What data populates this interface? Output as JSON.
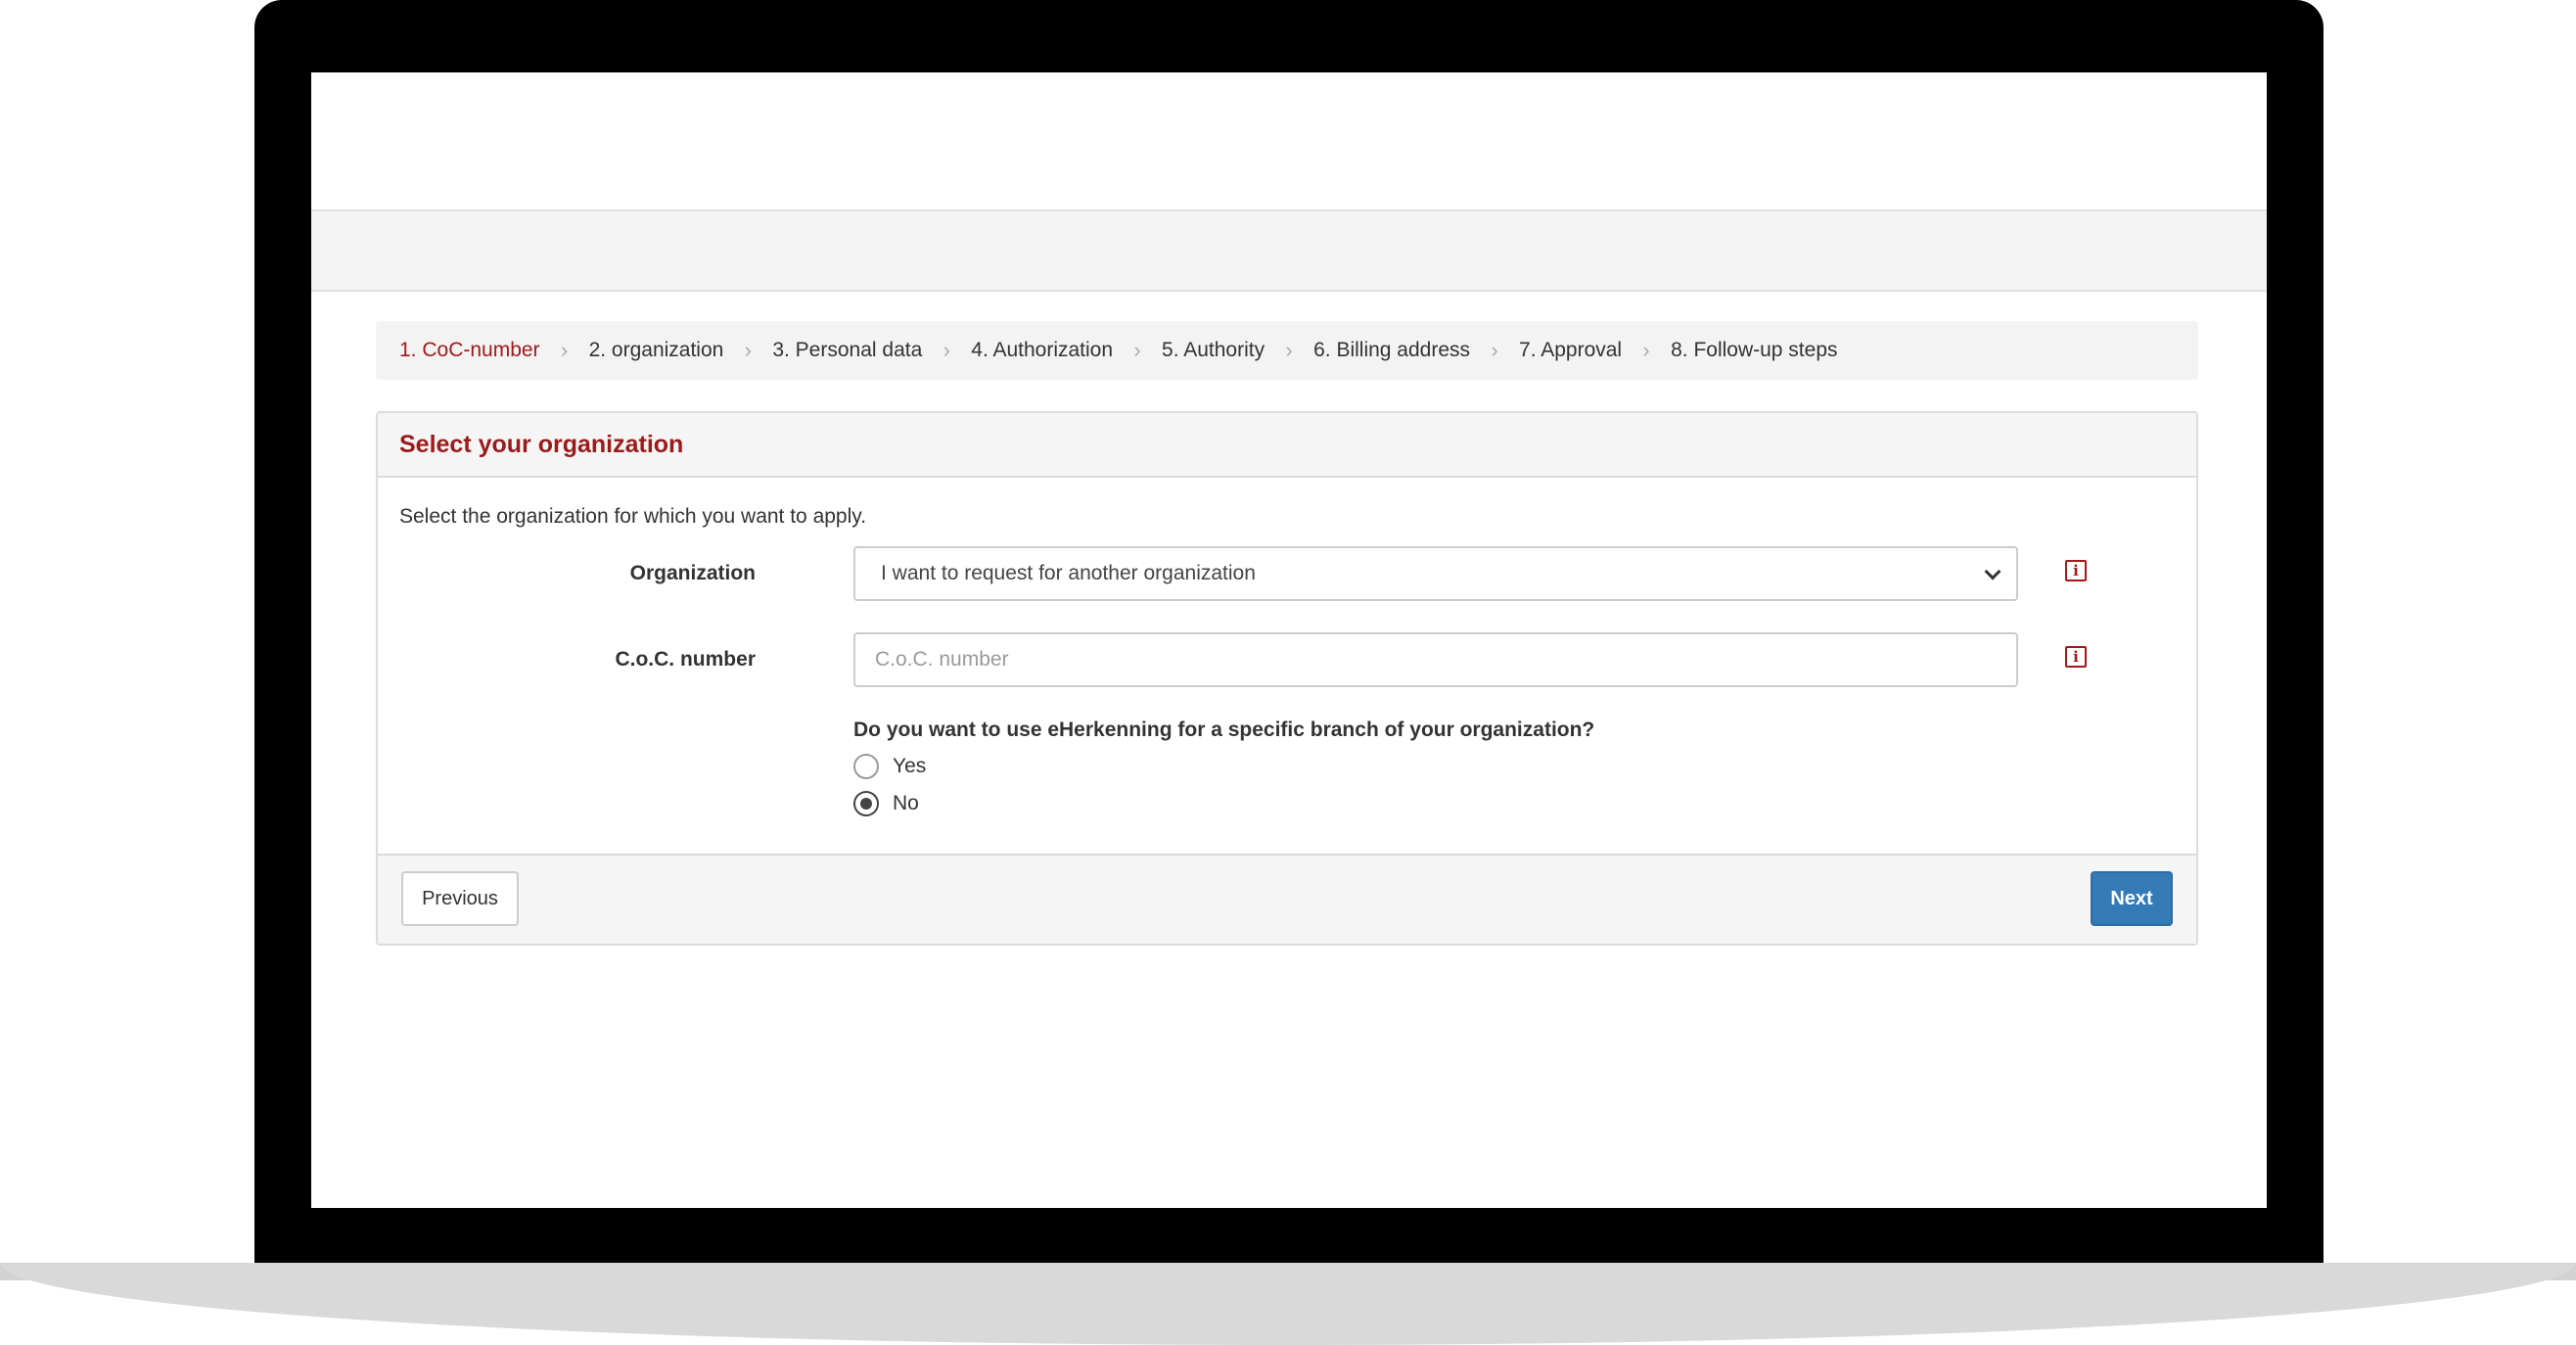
{
  "steps": [
    {
      "label": "1. CoC-number",
      "active": true
    },
    {
      "label": "2. organization"
    },
    {
      "label": "3. Personal data"
    },
    {
      "label": "4. Authorization"
    },
    {
      "label": "5. Authority"
    },
    {
      "label": "6. Billing address"
    },
    {
      "label": "7. Approval"
    },
    {
      "label": "8. Follow-up steps"
    }
  ],
  "panel": {
    "title": "Select your organization",
    "intro": "Select the organization for which you want to apply."
  },
  "form": {
    "organization": {
      "label": "Organization",
      "value": "I want to request for another organization"
    },
    "coc": {
      "label": "C.o.C. number",
      "placeholder": "C.o.C. number",
      "value": ""
    },
    "branch_question": "Do you want to use eHerkenning for a specific branch of your organization?",
    "options": [
      {
        "label": "Yes",
        "checked": false
      },
      {
        "label": "No",
        "checked": true
      }
    ]
  },
  "buttons": {
    "previous": "Previous",
    "next": "Next"
  },
  "icons": {
    "info": "info-icon",
    "chevron": "chevron-down-icon",
    "separator": "chevron-right-icon"
  },
  "colors": {
    "accent": "#9a1b1b",
    "primary": "#337ab7"
  }
}
